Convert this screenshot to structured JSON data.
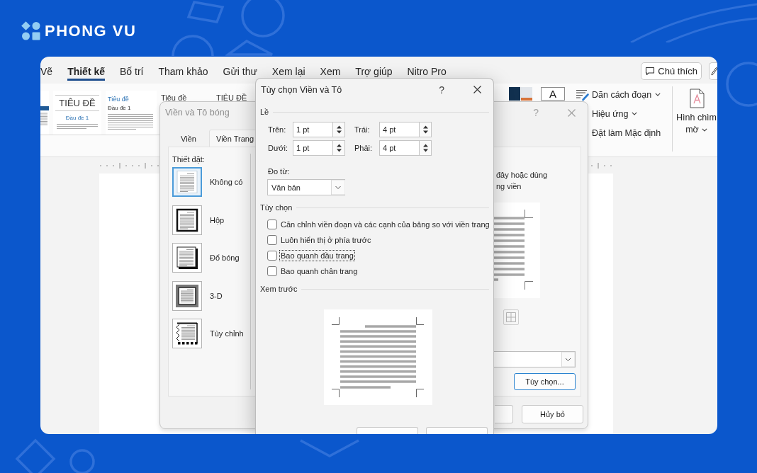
{
  "brand": {
    "name": "PHONG VU"
  },
  "ribbon_tabs": [
    {
      "label": "Vẽ",
      "selected": false
    },
    {
      "label": "Thiết kế",
      "selected": true
    },
    {
      "label": "Bố trí",
      "selected": false
    },
    {
      "label": "Tham khảo",
      "selected": false
    },
    {
      "label": "Gửi thư",
      "selected": false
    },
    {
      "label": "Xem lại",
      "selected": false
    },
    {
      "label": "Xem",
      "selected": false
    },
    {
      "label": "Trợ giúp",
      "selected": false
    },
    {
      "label": "Nitro Pro",
      "selected": false
    }
  ],
  "comments_button": {
    "label": "Chú thích"
  },
  "style_gallery": [
    {
      "kind": "bar"
    },
    {
      "kind": "title",
      "title": "TIÊU ĐỀ",
      "heading": "Đầu đề 1"
    },
    {
      "kind": "compact",
      "title": "Tiêu đề",
      "heading": "Đầu đề 1"
    },
    {
      "kind": "covered",
      "title": "Tiêu đề"
    },
    {
      "kind": "covered",
      "title": "TIÊU ĐỀ"
    }
  ],
  "fonts_button": {
    "label": "A"
  },
  "format_commands": [
    {
      "kind": "spacing",
      "label": "Dãn cách đoạn",
      "dropdown": true
    },
    {
      "kind": "plain",
      "label": "Hiệu ứng",
      "dropdown": true
    },
    {
      "kind": "plain",
      "label": "Đặt làm Mặc định",
      "dropdown": false
    }
  ],
  "watermark_button": {
    "label": "Hình chìm mờ",
    "dropdown": true
  },
  "borders_dialog": {
    "title": "Viền và Tô bóng",
    "active": false,
    "help": "?",
    "tabs": [
      {
        "label": "Viền",
        "selected": false
      },
      {
        "label": "Viền Trang",
        "selected": true
      }
    ],
    "settings_label": "Thiết đặt:",
    "settings": [
      {
        "kind": "none",
        "label": "Không có",
        "selected": true
      },
      {
        "kind": "box",
        "label": "Hộp",
        "selected": false
      },
      {
        "kind": "shadow",
        "label": "Đổ bóng",
        "selected": false
      },
      {
        "kind": "raised",
        "label": "3-D",
        "selected": false
      },
      {
        "kind": "custom",
        "label": "Tùy chỉnh",
        "selected": false
      }
    ],
    "hint_lines": [
      "đây hoặc dùng",
      "ng viền"
    ],
    "options_button": {
      "label": "Tùy chọn...",
      "focused": true
    },
    "cancel_button": {
      "label": "Hủy bỏ",
      "focused": false
    }
  },
  "options_dialog": {
    "title": "Tùy chọn Viền và Tô",
    "active": true,
    "help": "?",
    "margin_heading": "Lề",
    "margins": [
      {
        "label": "Trên:",
        "value": "1 pt"
      },
      {
        "label": "Trái:",
        "value": "4 pt"
      },
      {
        "label": "Dưới:",
        "value": "1 pt"
      },
      {
        "label": "Phải:",
        "value": "4 pt"
      }
    ],
    "measure_label": "Đo từ:",
    "measure_value": "Văn bản",
    "options_heading": "Tùy chọn",
    "options": [
      {
        "label": "Căn chỉnh viền đoạn và các cạnh của bảng so với viền trang",
        "checked": false,
        "focused": false
      },
      {
        "label": "Luôn hiển thị ở phía trước",
        "checked": false,
        "focused": false
      },
      {
        "label": "Bao quanh đầu trang",
        "checked": false,
        "focused": true
      },
      {
        "label": "Bao quanh chân trang",
        "checked": false,
        "focused": false
      }
    ],
    "preview_heading": "Xem trước"
  }
}
